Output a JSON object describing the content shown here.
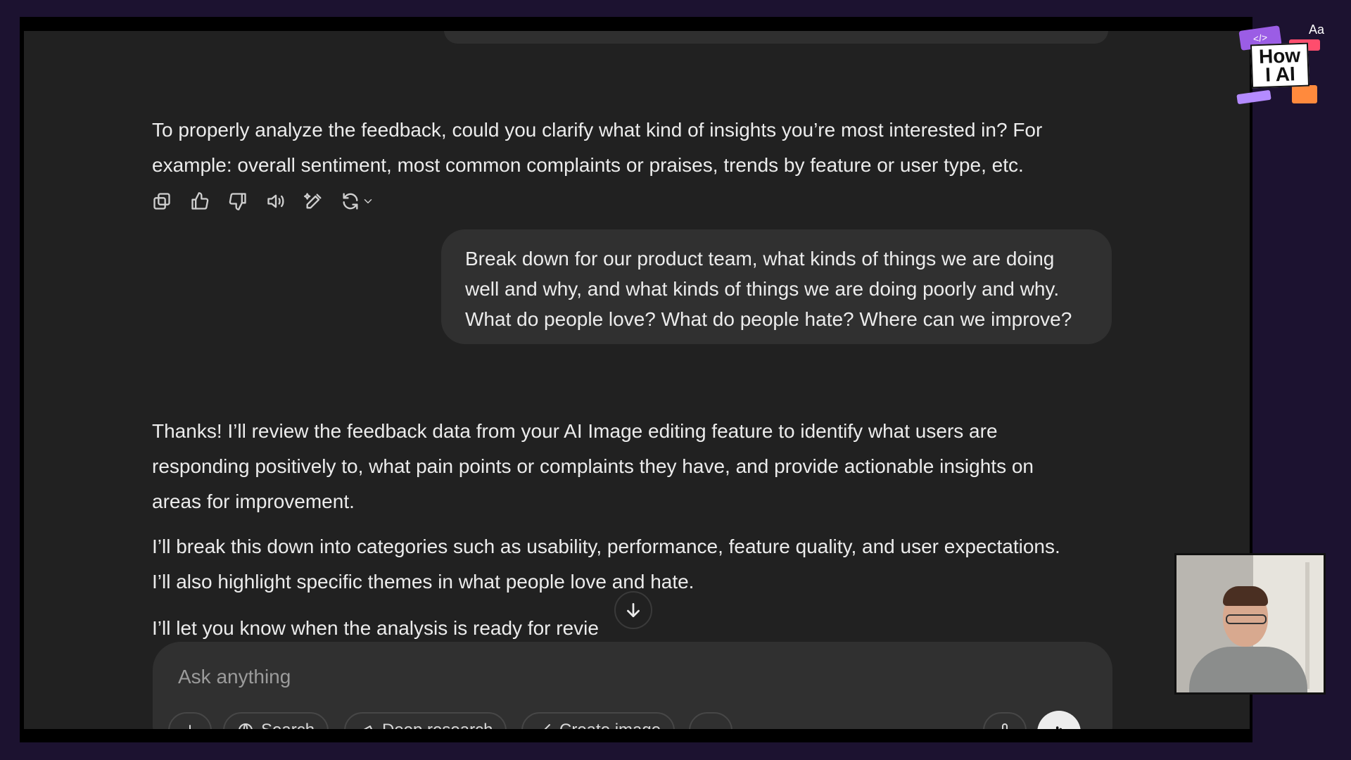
{
  "assistant_reply_1": [
    "To properly analyze the feedback, could you clarify what kind of insights you’re most interested in? For",
    "example: overall sentiment, most common complaints or praises, trends by feature or user type, etc."
  ],
  "user_message": [
    "Break down for our product team, what kinds of things we are doing",
    "well and why, and what kinds of things we are doing poorly and why.",
    "What do people love? What do people hate? Where can we improve?"
  ],
  "assistant_reply_2": {
    "p1": [
      "Thanks! I’ll review the feedback data from your AI Image editing feature to identify what users are",
      "responding positively to, what pain points or complaints they have, and provide actionable insights on",
      "areas for improvement."
    ],
    "p2": [
      "I’ll break this down into categories such as usability, performance, feature quality, and user expectations.",
      "I’ll also highlight specific themes in what people love and hate."
    ],
    "p3": "I’ll let you know when the analysis is ready for revie"
  },
  "actions": [
    "copy-icon",
    "thumbs-up-icon",
    "thumbs-down-icon",
    "read-aloud-icon",
    "edit-icon",
    "regenerate-icon"
  ],
  "composer": {
    "placeholder": "Ask anything",
    "tools": [
      "Search",
      "Deep research",
      "Create image"
    ]
  },
  "logo": {
    "line1": "How",
    "line2": "I AI",
    "aa": "Aa",
    "code": "</>"
  },
  "colors": {
    "background": "#212121",
    "bubble": "#303030",
    "text": "#ececec",
    "outer": "#1c1230"
  }
}
